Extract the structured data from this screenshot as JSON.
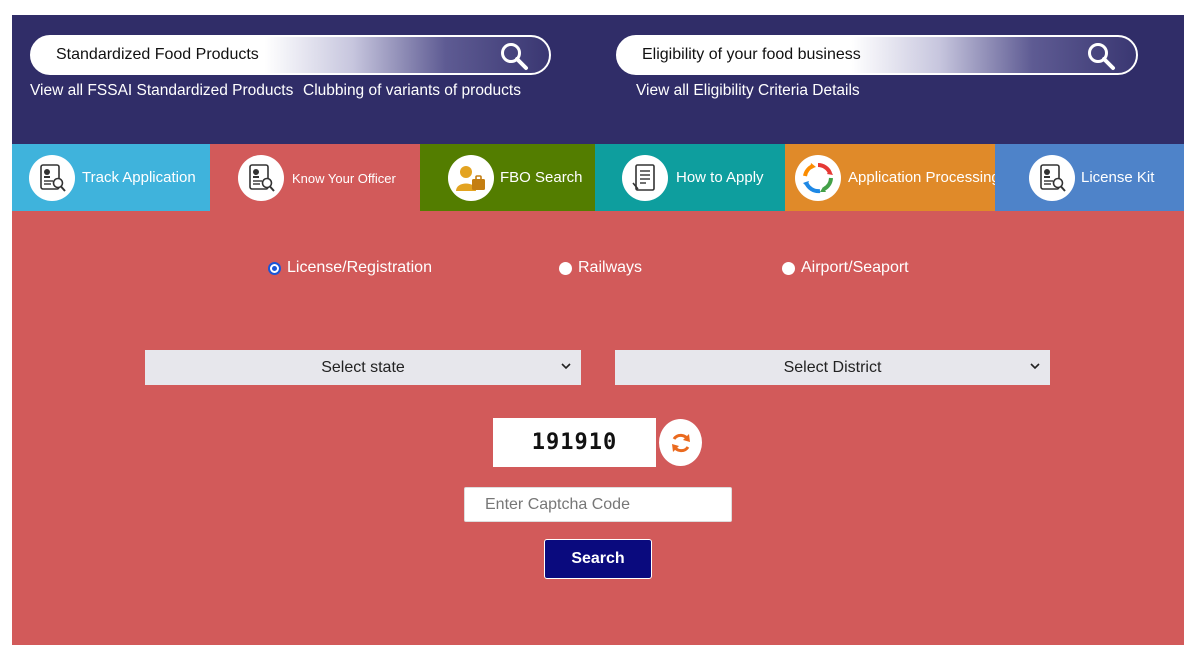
{
  "top": {
    "left_search": {
      "label": "Standardized Food Products"
    },
    "right_search": {
      "label": "Eligibility of your food business"
    },
    "links": {
      "standardized": "View all FSSAI Standardized Products",
      "clubbing": "Clubbing of variants of products",
      "eligibility": "View all Eligibility Criteria Details"
    }
  },
  "tabs": [
    {
      "label": "Track Application",
      "color": "#3fb3dc",
      "icon": "id-card-search-icon"
    },
    {
      "label": "Know Your Officer",
      "color": "#d25a5a",
      "icon": "id-card-search-icon"
    },
    {
      "label": "FBO Search",
      "color": "#537d00",
      "icon": "person-briefcase-icon"
    },
    {
      "label": "How to Apply",
      "color": "#0e9e9e",
      "icon": "form-document-icon"
    },
    {
      "label": "Application Processing",
      "color": "#e08a29",
      "icon": "circular-arrows-icon"
    },
    {
      "label": "License Kit",
      "color": "#4e83c9",
      "icon": "id-card-search-icon"
    }
  ],
  "search_form": {
    "radios": [
      {
        "label": "License/Registration",
        "selected": true
      },
      {
        "label": "Railways",
        "selected": false
      },
      {
        "label": "Airport/Seaport",
        "selected": false
      }
    ],
    "state_select": "Select state",
    "district_select": "Select District",
    "captcha_value": "191910",
    "captcha_placeholder": "Enter Captcha Code",
    "search_button": "Search"
  },
  "colors": {
    "header_bg": "#302d68",
    "panel_bg": "#d25a5a",
    "button_bg": "#0a0a7e",
    "refresh_icon": "#ea6a1f"
  }
}
